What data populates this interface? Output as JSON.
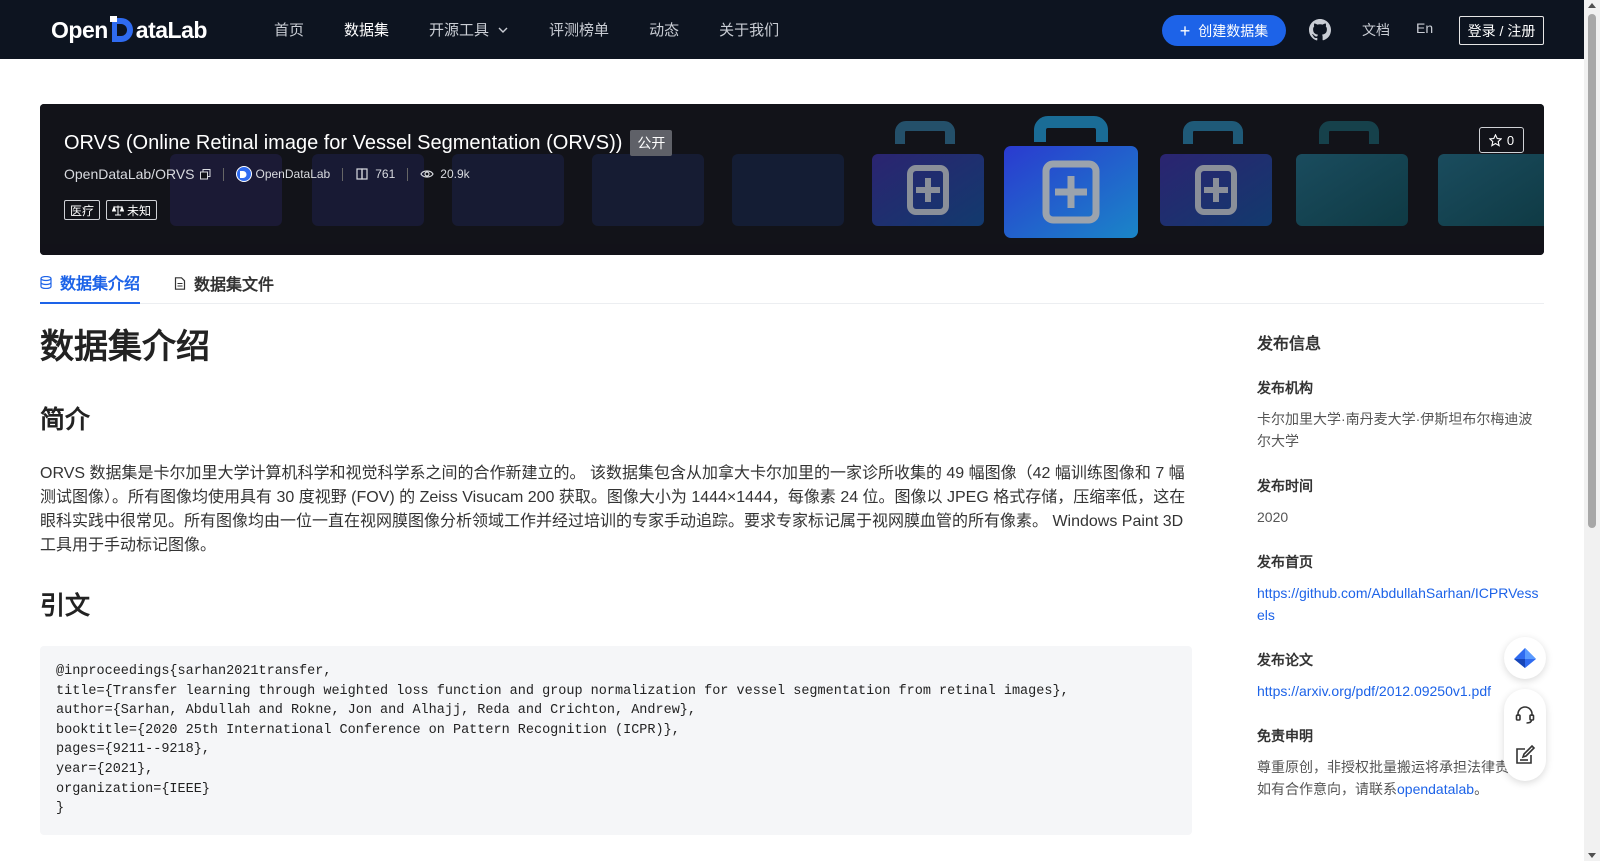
{
  "nav": {
    "logo_left": "Open",
    "logo_right": "ataLab",
    "items": [
      {
        "label": "首页",
        "active": false
      },
      {
        "label": "数据集",
        "active": true
      },
      {
        "label": "开源工具",
        "active": false
      },
      {
        "label": "评测榜单",
        "active": false
      },
      {
        "label": "动态",
        "active": false
      },
      {
        "label": "关于我们",
        "active": false
      }
    ],
    "create_label": "创建数据集",
    "docs_label": "文档",
    "lang_label": "En",
    "login_label": "登录 / 注册",
    "accent": "#1d63e8"
  },
  "banner": {
    "title": "ORVS (Online Retinal image for Vessel Segmentation (ORVS))",
    "badge": "公开",
    "repo": "OpenDataLab/ORVS",
    "org": "OpenDataLab",
    "downloads": "761",
    "views": "20.9k",
    "tags": [
      "医疗",
      "未知"
    ],
    "stars": "0"
  },
  "tabs": [
    {
      "label": "数据集介绍",
      "icon": "database-icon",
      "active": true
    },
    {
      "label": "数据集文件",
      "icon": "file-icon",
      "active": false
    }
  ],
  "content": {
    "title": "数据集介绍",
    "intro_heading": "简介",
    "intro": "ORVS 数据集是卡尔加里大学计算机科学和视觉科学系之间的合作新建立的。 该数据集包含从加拿大卡尔加里的一家诊所收集的 49 幅图像（42 幅训练图像和 7 幅测试图像）。所有图像均使用具有 30 度视野 (FOV) 的 Zeiss Visucam 200 获取。图像大小为 1444×1444，每像素 24 位。图像以 JPEG 格式存储，压缩率低，这在眼科实践中很常见。所有图像均由一位一直在视网膜图像分析领域工作并经过培训的专家手动追踪。要求专家标记属于视网膜血管的所有像素。 Windows Paint 3D 工具用于手动标记图像。",
    "citation_heading": "引文",
    "citation": "@inproceedings{sarhan2021transfer,\ntitle={Transfer learning through weighted loss function and group normalization for vessel segmentation from retinal images},\nauthor={Sarhan, Abdullah and Rokne, Jon and Alhajj, Reda and Crichton, Andrew},\nbooktitle={2020 25th International Conference on Pattern Recognition (ICPR)},\npages={9211--9218},\nyear={2021},\norganization={IEEE}\n}"
  },
  "sidebar": {
    "heading": "发布信息",
    "publisher_label": "发布机构",
    "publisher": "卡尔加里大学·南丹麦大学·伊斯坦布尔梅迪波尔大学",
    "time_label": "发布时间",
    "time": "2020",
    "homepage_label": "发布首页",
    "homepage": "https://github.com/AbdullahSarhan/ICPRVessels",
    "paper_label": "发布论文",
    "paper": "https://arxiv.org/pdf/2012.09250v1.pdf",
    "disclaimer_label": "免责申明",
    "disclaimer_1": "尊重原创，非授权批量搬运将承担法律责",
    "disclaimer_2": "如有合作意向，请联系",
    "disclaimer_link": "opendatalab",
    "disclaimer_end": "。"
  }
}
